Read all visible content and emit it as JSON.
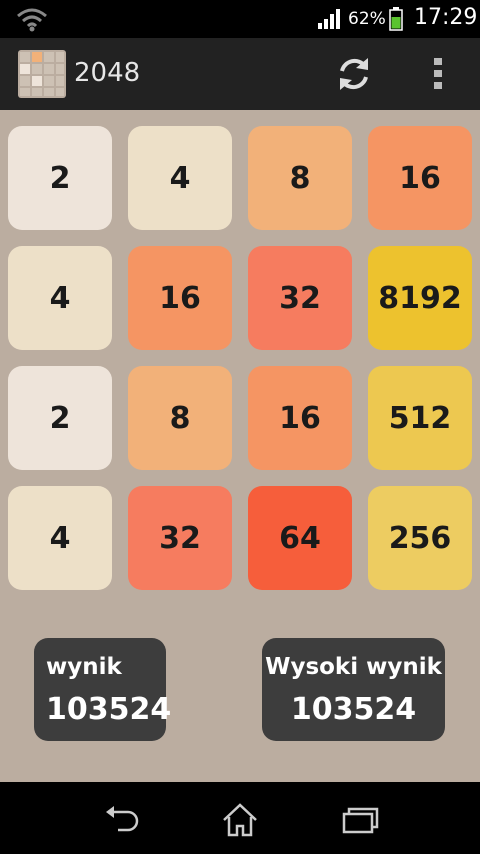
{
  "status_bar": {
    "battery_percent": "62%",
    "time": "17:29",
    "icons": [
      "wifi-icon",
      "signal-icon",
      "battery-icon"
    ]
  },
  "action_bar": {
    "title": "2048",
    "icons": [
      "app-icon",
      "refresh-icon",
      "overflow-menu-icon"
    ]
  },
  "board": {
    "tiles": [
      [
        "2",
        "4",
        "8",
        "16"
      ],
      [
        "4",
        "16",
        "32",
        "8192"
      ],
      [
        "2",
        "8",
        "16",
        "512"
      ],
      [
        "4",
        "32",
        "64",
        "256"
      ]
    ]
  },
  "score": {
    "label": "wynik",
    "value": "103524"
  },
  "high_score": {
    "label": "Wysoki wynik",
    "value": "103524"
  },
  "nav_bar": {
    "icons": [
      "back-icon",
      "home-icon",
      "recent-apps-icon"
    ]
  },
  "colors": {
    "background": "#bbada0",
    "tile_2": "#eee4da",
    "tile_4": "#ede0c8",
    "tile_8": "#f2b179",
    "tile_16": "#f59563",
    "tile_32": "#f67c5f",
    "tile_64": "#f65e3b",
    "tile_256": "#edcc61",
    "tile_512": "#edc850",
    "tile_8192": "#edc22e",
    "score_box": "#3d3d3d"
  }
}
